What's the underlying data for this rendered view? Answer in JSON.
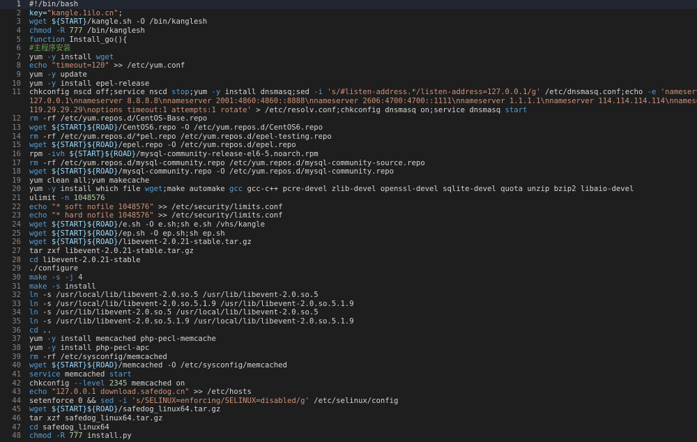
{
  "lines": [
    {
      "n": "1",
      "parts": [
        [
          "#!/bin/bash",
          "cmd"
        ]
      ]
    },
    {
      "n": "2",
      "parts": [
        [
          "key=",
          "var"
        ],
        [
          "\"kangle.1ilo.cn\"",
          "str"
        ],
        [
          ";",
          "cmd"
        ]
      ]
    },
    {
      "n": "3",
      "parts": [
        [
          "wget ",
          "kw"
        ],
        [
          "${START}",
          "var"
        ],
        [
          "/kangle.sh -O /bin/kanglesh",
          "cmd"
        ]
      ]
    },
    {
      "n": "4",
      "parts": [
        [
          "chmod ",
          "kw"
        ],
        [
          "-R ",
          "kw"
        ],
        [
          "777",
          "num"
        ],
        [
          " /bin/kanglesh",
          "cmd"
        ]
      ]
    },
    {
      "n": "5",
      "parts": [
        [
          "function ",
          "kw"
        ],
        [
          "Install_go(){",
          "cmd"
        ]
      ]
    },
    {
      "n": "6",
      "parts": [
        [
          "#主程序安装",
          "cmt"
        ]
      ]
    },
    {
      "n": "7",
      "parts": [
        [
          "yum ",
          "cmd"
        ],
        [
          "-y ",
          "kw"
        ],
        [
          "install ",
          "cmd"
        ],
        [
          "wget",
          "kw"
        ]
      ]
    },
    {
      "n": "8",
      "parts": [
        [
          "echo ",
          "kw"
        ],
        [
          "\"timeout=120\"",
          "str"
        ],
        [
          " >> /etc/yum.conf",
          "cmd"
        ]
      ]
    },
    {
      "n": "9",
      "parts": [
        [
          "yum ",
          "cmd"
        ],
        [
          "-y ",
          "kw"
        ],
        [
          "update",
          "cmd"
        ]
      ]
    },
    {
      "n": "10",
      "parts": [
        [
          "yum ",
          "cmd"
        ],
        [
          "-y ",
          "kw"
        ],
        [
          "install epel-release",
          "cmd"
        ]
      ]
    },
    {
      "n": "11",
      "parts": [
        [
          "chkconfig nscd off;service nscd ",
          "cmd"
        ],
        [
          "stop",
          "kw"
        ],
        [
          ";yum ",
          "cmd"
        ],
        [
          "-y ",
          "kw"
        ],
        [
          "install dnsmasq;sed ",
          "cmd"
        ],
        [
          "-i ",
          "kw"
        ],
        [
          "'s/#listen-address.*/listen-address=127.0.0.1/g'",
          "str"
        ],
        [
          " /etc/dnsmasq.conf;echo ",
          "cmd"
        ],
        [
          "-e ",
          "kw"
        ],
        [
          "'nameserver",
          "str"
        ]
      ]
    },
    {
      "n": "",
      "parts": [
        [
          "127.0.0.1\\nnameserver 8.8.8.8\\nnameserver 2001:4860:4860::8888\\nnameserver 2606:4700:4700::1111\\nnameserver 1.1.1.1\\nnameserver 114.114.114.114\\nnameserver",
          "str"
        ]
      ]
    },
    {
      "n": "",
      "parts": [
        [
          "119.29.29.29\\noptions timeout:1 attempts:1 rotate'",
          "str"
        ],
        [
          " > /etc/resolv.conf;chkconfig dnsmasq on;service dnsmasq ",
          "cmd"
        ],
        [
          "start",
          "kw"
        ]
      ]
    },
    {
      "n": "12",
      "parts": [
        [
          "rm ",
          "kw"
        ],
        [
          "-rf /etc/yum.repos.d/CentOS-Base.repo",
          "cmd"
        ]
      ]
    },
    {
      "n": "13",
      "parts": [
        [
          "wget ",
          "kw"
        ],
        [
          "${START}${ROAD}",
          "var"
        ],
        [
          "/CentOS6.repo -O /etc/yum.repos.d/CentOS6.repo",
          "cmd"
        ]
      ]
    },
    {
      "n": "14",
      "parts": [
        [
          "rm ",
          "kw"
        ],
        [
          "-rf /etc/yum.repos.d/*pel.repo /etc/yum.repos.d/epel-testing.repo",
          "cmd"
        ]
      ]
    },
    {
      "n": "15",
      "parts": [
        [
          "wget ",
          "kw"
        ],
        [
          "${START}${ROAD}",
          "var"
        ],
        [
          "/epel.repo -O /etc/yum.repos.d/epel.repo",
          "cmd"
        ]
      ]
    },
    {
      "n": "16",
      "parts": [
        [
          "rpm ",
          "cmd"
        ],
        [
          "-ivh ",
          "kw"
        ],
        [
          "${START}${ROAD}",
          "var"
        ],
        [
          "/mysql-community-release-el6-5.noarch.rpm",
          "cmd"
        ]
      ]
    },
    {
      "n": "17",
      "parts": [
        [
          "rm ",
          "kw"
        ],
        [
          "-rf /etc/yum.repos.d/mysql-community.repo /etc/yum.repos.d/mysql-community-source.repo",
          "cmd"
        ]
      ]
    },
    {
      "n": "18",
      "parts": [
        [
          "wget ",
          "kw"
        ],
        [
          "${START}${ROAD}",
          "var"
        ],
        [
          "/mysql-community.repo -O /etc/yum.repos.d/mysql-community.repo",
          "cmd"
        ]
      ]
    },
    {
      "n": "19",
      "parts": [
        [
          "yum clean all;yum makecache",
          "cmd"
        ]
      ]
    },
    {
      "n": "20",
      "parts": [
        [
          "yum ",
          "cmd"
        ],
        [
          "-y ",
          "kw"
        ],
        [
          "install which file ",
          "cmd"
        ],
        [
          "wget",
          "kw"
        ],
        [
          ";make automake ",
          "cmd"
        ],
        [
          "gcc",
          "kw"
        ],
        [
          " gcc-c++ pcre-devel zlib-devel openssl-devel sqlite-devel quota unzip bzip2 libaio-devel",
          "cmd"
        ]
      ]
    },
    {
      "n": "21",
      "parts": [
        [
          "ulimit ",
          "cmd"
        ],
        [
          "-n ",
          "kw"
        ],
        [
          "1048576",
          "num"
        ]
      ]
    },
    {
      "n": "22",
      "parts": [
        [
          "echo ",
          "kw"
        ],
        [
          "\"* soft nofile 1048576\"",
          "str"
        ],
        [
          " >> /etc/security/limits.conf",
          "cmd"
        ]
      ]
    },
    {
      "n": "23",
      "parts": [
        [
          "echo ",
          "kw"
        ],
        [
          "\"* hard nofile 1048576\"",
          "str"
        ],
        [
          " >> /etc/security/limits.conf",
          "cmd"
        ]
      ]
    },
    {
      "n": "24",
      "parts": [
        [
          "wget ",
          "kw"
        ],
        [
          "${START}${ROAD}",
          "var"
        ],
        [
          "/e.sh -O e.sh;sh e.sh /vhs/kangle",
          "cmd"
        ]
      ]
    },
    {
      "n": "25",
      "parts": [
        [
          "wget ",
          "kw"
        ],
        [
          "${START}${ROAD}",
          "var"
        ],
        [
          "/ep.sh -O ep.sh;sh ep.sh",
          "cmd"
        ]
      ]
    },
    {
      "n": "26",
      "parts": [
        [
          "wget ",
          "kw"
        ],
        [
          "${START}${ROAD}",
          "var"
        ],
        [
          "/libevent-2.0.21-stable.tar.gz",
          "cmd"
        ]
      ]
    },
    {
      "n": "27",
      "parts": [
        [
          "tar zxf libevent-2.0.21-stable.tar.gz",
          "cmd"
        ]
      ]
    },
    {
      "n": "28",
      "parts": [
        [
          "cd ",
          "kw"
        ],
        [
          "libevent-2.0.21-stable",
          "cmd"
        ]
      ]
    },
    {
      "n": "29",
      "parts": [
        [
          "./configure",
          "cmd"
        ]
      ]
    },
    {
      "n": "30",
      "parts": [
        [
          "make ",
          "kw"
        ],
        [
          "-s ",
          "kw"
        ],
        [
          "-j ",
          "kw"
        ],
        [
          "4",
          "num"
        ]
      ]
    },
    {
      "n": "31",
      "parts": [
        [
          "make ",
          "kw"
        ],
        [
          "-s ",
          "kw"
        ],
        [
          "install",
          "cmd"
        ]
      ]
    },
    {
      "n": "32",
      "parts": [
        [
          "ln ",
          "kw"
        ],
        [
          "-s /usr/local/lib/libevent-2.0.so.5 /usr/lib/libevent-2.0.so.5",
          "cmd"
        ]
      ]
    },
    {
      "n": "33",
      "parts": [
        [
          "ln ",
          "kw"
        ],
        [
          "-s /usr/local/lib/libevent-2.0.so.5.1.9 /usr/lib/libevent-2.0.so.5.1.9",
          "cmd"
        ]
      ]
    },
    {
      "n": "34",
      "parts": [
        [
          "ln ",
          "kw"
        ],
        [
          "-s /usr/lib/libevent-2.0.so.5 /usr/local/lib/libevent-2.0.so.5",
          "cmd"
        ]
      ]
    },
    {
      "n": "35",
      "parts": [
        [
          "ln ",
          "kw"
        ],
        [
          "-s /usr/lib/libevent-2.0.so.5.1.9 /usr/local/lib/libevent-2.0.so.5.1.9",
          "cmd"
        ]
      ]
    },
    {
      "n": "36",
      "parts": [
        [
          "cd ",
          "kw"
        ],
        [
          "..",
          "cmd"
        ]
      ]
    },
    {
      "n": "37",
      "parts": [
        [
          "yum ",
          "cmd"
        ],
        [
          "-y ",
          "kw"
        ],
        [
          "install memcached php-pecl-memcache",
          "cmd"
        ]
      ]
    },
    {
      "n": "38",
      "parts": [
        [
          "yum ",
          "cmd"
        ],
        [
          "-y ",
          "kw"
        ],
        [
          "install php-pecl-apc",
          "cmd"
        ]
      ]
    },
    {
      "n": "39",
      "parts": [
        [
          "rm ",
          "kw"
        ],
        [
          "-rf /etc/sysconfig/memcached",
          "cmd"
        ]
      ]
    },
    {
      "n": "40",
      "parts": [
        [
          "wget ",
          "kw"
        ],
        [
          "${START}${ROAD}",
          "var"
        ],
        [
          "/memcached -O /etc/sysconfig/memcached",
          "cmd"
        ]
      ]
    },
    {
      "n": "41",
      "parts": [
        [
          "service ",
          "kw"
        ],
        [
          "memcached ",
          "cmd"
        ],
        [
          "start",
          "kw"
        ]
      ]
    },
    {
      "n": "42",
      "parts": [
        [
          "chkconfig ",
          "cmd"
        ],
        [
          "--level ",
          "kw"
        ],
        [
          "2345",
          "num"
        ],
        [
          " memcached on",
          "cmd"
        ]
      ]
    },
    {
      "n": "43",
      "parts": [
        [
          "echo ",
          "kw"
        ],
        [
          "\"127.0.0.1 download.safedog.cn\"",
          "str"
        ],
        [
          " >> /etc/hosts",
          "cmd"
        ]
      ]
    },
    {
      "n": "44",
      "parts": [
        [
          "setenforce 0 && ",
          "cmd"
        ],
        [
          "sed ",
          "kw"
        ],
        [
          "-i ",
          "kw"
        ],
        [
          "'s/SELINUX=enforcing/SELINUX=disabled/g'",
          "str"
        ],
        [
          " /etc/selinux/config",
          "cmd"
        ]
      ]
    },
    {
      "n": "45",
      "parts": [
        [
          "wget ",
          "kw"
        ],
        [
          "${START}${ROAD}",
          "var"
        ],
        [
          "/safedog_linux64.tar.gz",
          "cmd"
        ]
      ]
    },
    {
      "n": "46",
      "parts": [
        [
          "tar xzf safedog_linux64.tar.gz",
          "cmd"
        ]
      ]
    },
    {
      "n": "47",
      "parts": [
        [
          "cd ",
          "kw"
        ],
        [
          "safedog_linux64",
          "cmd"
        ]
      ]
    },
    {
      "n": "48",
      "parts": [
        [
          "chmod ",
          "kw"
        ],
        [
          "-R ",
          "kw"
        ],
        [
          "777",
          "num"
        ],
        [
          " install.py",
          "cmd"
        ]
      ]
    }
  ]
}
